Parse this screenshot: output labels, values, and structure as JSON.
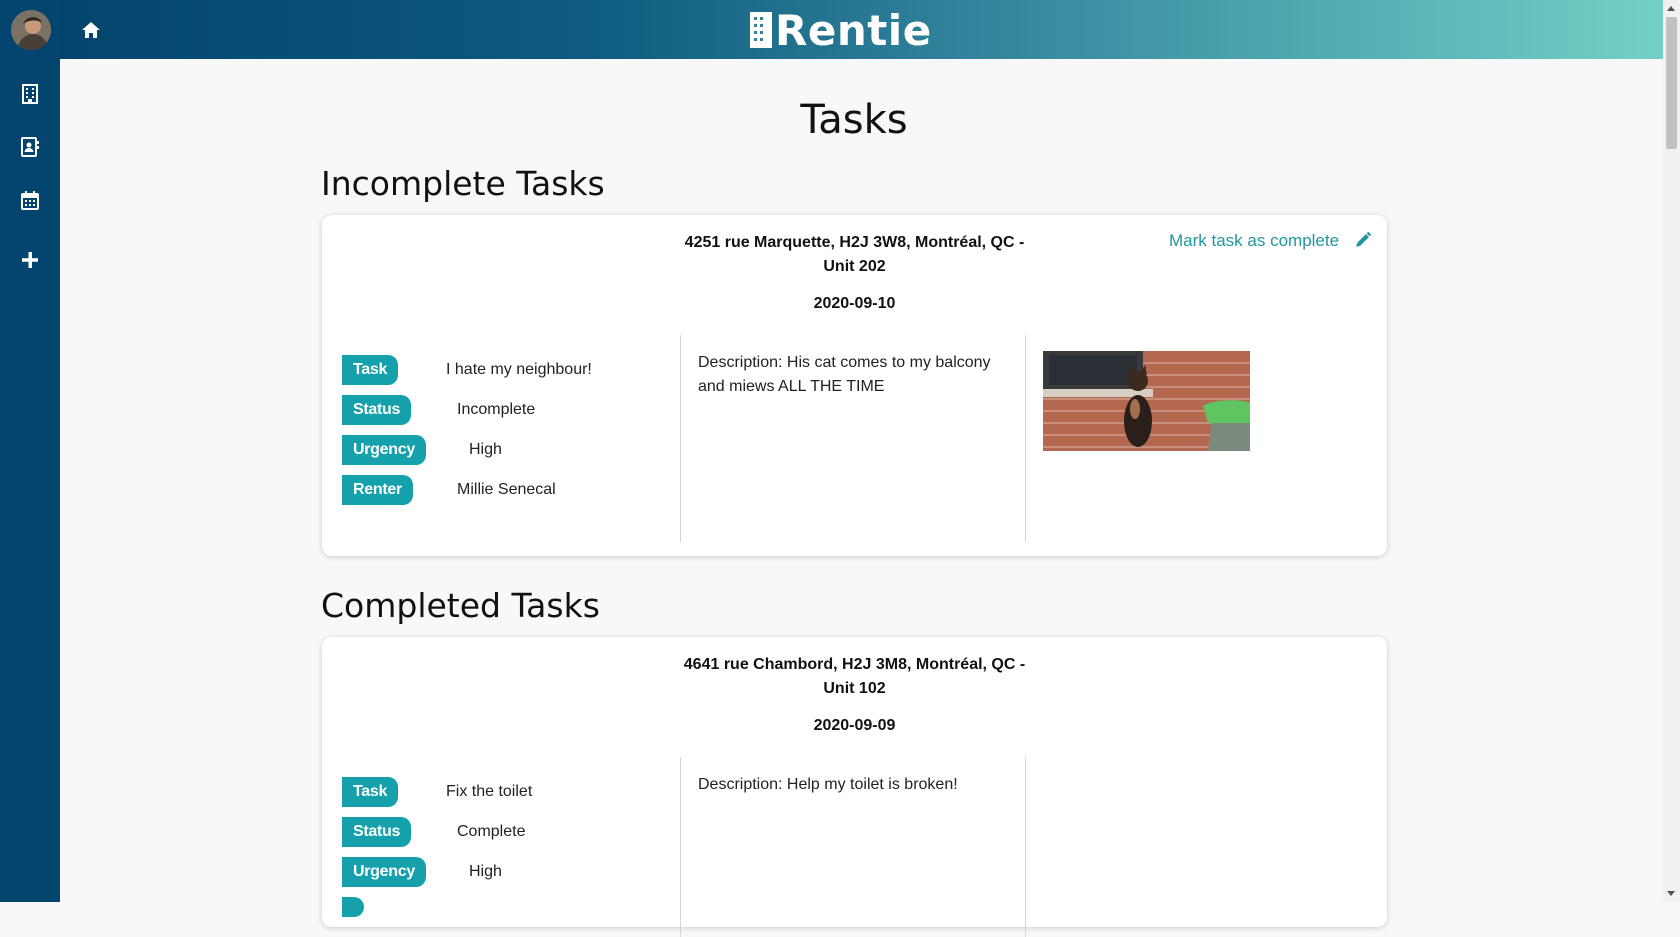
{
  "header": {
    "brand": "Rentie"
  },
  "sidebar": {
    "icons": [
      "avatar",
      "building-icon",
      "contacts-icon",
      "calendar-icon",
      "plus-icon"
    ]
  },
  "page": {
    "title": "Tasks"
  },
  "incomplete": {
    "heading": "Incomplete Tasks",
    "tasks": [
      {
        "address_line1": "4251 rue Marquette, H2J 3W8, Montréal, QC -",
        "address_line2": "Unit 202",
        "date": "2020-09-10",
        "action": "Mark task as complete",
        "task_label": "Task",
        "task": "I hate my neighbour!",
        "status_label": "Status",
        "status": "Incomplete",
        "urgency_label": "Urgency",
        "urgency": "High",
        "renter_label": "Renter",
        "renter": "Millie Senecal",
        "description_line1": "Description: His cat comes to my balcony",
        "description_line2": "and miews ALL THE TIME",
        "photo": "cat-on-balcony-photo"
      }
    ]
  },
  "completed": {
    "heading": "Completed Tasks",
    "tasks": [
      {
        "address_line1": "4641 rue Chambord, H2J 3M8, Montréal, QC -",
        "address_line2": "Unit 102",
        "date": "2020-09-09",
        "task_label": "Task",
        "task": "Fix the toilet",
        "status_label": "Status",
        "status": "Complete",
        "urgency_label": "Urgency",
        "urgency": "High",
        "description_line1": "Description: Help my toilet is broken!"
      }
    ]
  },
  "colors": {
    "sidebar": "#03456e",
    "accent": "#14a1ab",
    "link": "#23959f",
    "header_start": "#01426a",
    "header_end": "#74d0c6"
  }
}
